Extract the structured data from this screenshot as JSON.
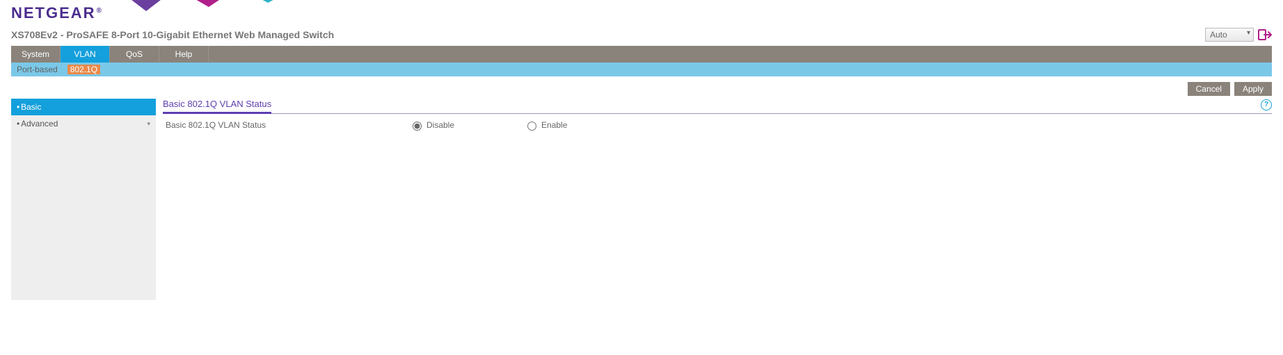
{
  "brand": "NETGEAR",
  "product_line": "XS708Ev2 - ProSAFE 8-Port 10-Gigabit Ethernet Web Managed Switch",
  "language": {
    "selected": "Auto"
  },
  "nav1": {
    "items": [
      {
        "label": "System",
        "active": false
      },
      {
        "label": "VLAN",
        "active": true
      },
      {
        "label": "QoS",
        "active": false
      },
      {
        "label": "Help",
        "active": false
      }
    ]
  },
  "nav2": {
    "items": [
      {
        "label": "Port-based",
        "active": false
      },
      {
        "label": "802.1Q",
        "active": true
      }
    ]
  },
  "actions": {
    "cancel": "Cancel",
    "apply": "Apply"
  },
  "sidebar": {
    "items": [
      {
        "label": "Basic",
        "active": true,
        "expandable": false
      },
      {
        "label": "Advanced",
        "active": false,
        "expandable": true
      }
    ]
  },
  "panel": {
    "title": "Basic 802.1Q VLAN Status",
    "setting_label": "Basic 802.1Q VLAN Status",
    "options": {
      "disable": "Disable",
      "enable": "Enable",
      "selected": "disable"
    }
  }
}
